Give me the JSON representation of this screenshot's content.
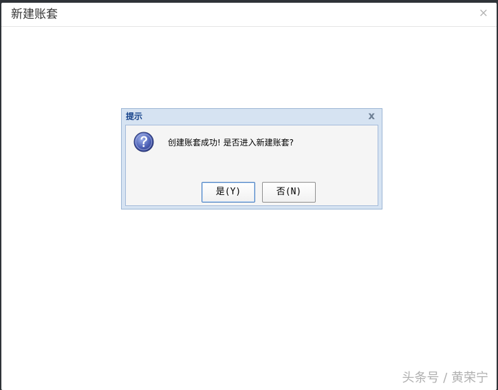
{
  "window": {
    "title": "新建账套",
    "close_glyph": "×"
  },
  "dialog": {
    "title": "提示",
    "close_glyph": "x",
    "icon": "question-icon",
    "message": "创建账套成功! 是否进入新建账套?",
    "yes_label": "是(Y)",
    "no_label": "否(N)"
  },
  "watermark": {
    "text": "头条号 / 黄荣宁"
  },
  "colors": {
    "dialog_title": "#15428b",
    "dialog_frame": "#d6e3f2",
    "yes_button_border": "#4a7fc0"
  }
}
